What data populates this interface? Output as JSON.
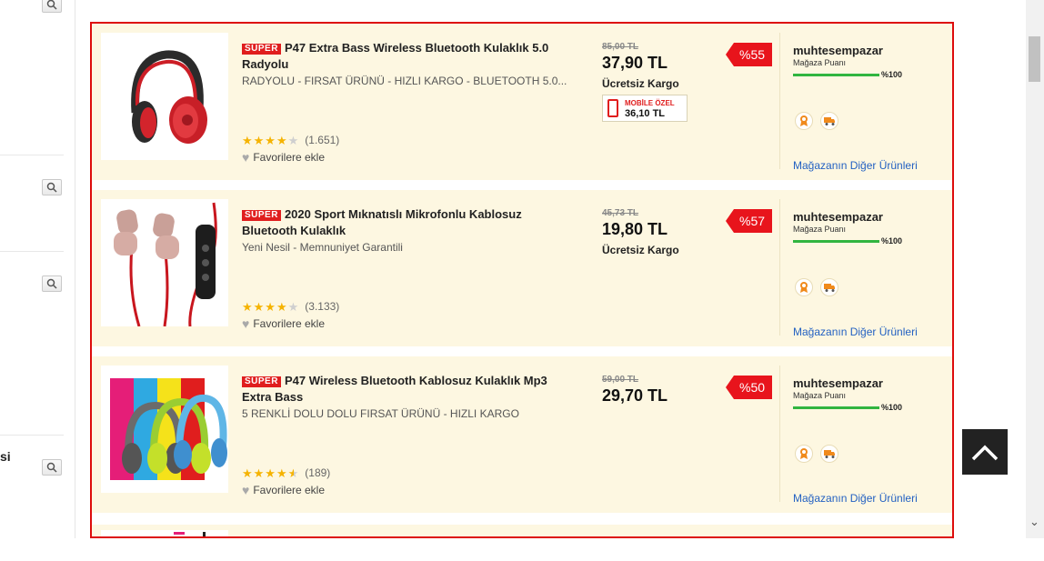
{
  "sidebar": {
    "partial_label": "si"
  },
  "products": [
    {
      "super_label": "SÜPER",
      "title": "P47 Extra Bass Wireless Bluetooth Kulaklık 5.0 Radyolu",
      "subtitle": "RADYOLU - FIRSAT ÜRÜNÜ - HIZLI KARGO - BLUETOOTH 5.0...",
      "rating_stars": 4,
      "review_count": "(1.651)",
      "favorite_label": "Favorilere ekle",
      "old_price": "85,00 TL",
      "price": "37,90 TL",
      "shipping": "Ücretsiz Kargo",
      "mobile_label": "MOBİLE ÖZEL",
      "mobile_price": "36,10 TL",
      "discount": "%55",
      "store_name": "muhtesempazar",
      "store_score_label": "Mağaza Puanı",
      "store_score": "%100",
      "store_link": "Mağazanın Diğer Ürünleri",
      "image_icon": "red-headphones"
    },
    {
      "super_label": "SÜPER",
      "title": "2020 Sport Mıknatıslı Mikrofonlu Kablosuz Bluetooth Kulaklık",
      "subtitle": "Yeni Nesil - Memnuniyet Garantili",
      "rating_stars": 4,
      "review_count": "(3.133)",
      "favorite_label": "Favorilere ekle",
      "old_price": "45,73 TL",
      "price": "19,80 TL",
      "shipping": "Ücretsiz Kargo",
      "discount": "%57",
      "store_name": "muhtesempazar",
      "store_score_label": "Mağaza Puanı",
      "store_score": "%100",
      "store_link": "Mağazanın Diğer Ürünleri",
      "image_icon": "sport-earphones"
    },
    {
      "super_label": "SÜPER",
      "title": "P47 Wireless Bluetooth Kablosuz Kulaklık Mp3 Extra Bass",
      "subtitle": "5 RENKLİ DOLU DOLU FIRSAT ÜRÜNÜ - HIZLI KARGO",
      "rating_stars": 4.5,
      "review_count": "(189)",
      "favorite_label": "Favorilere ekle",
      "old_price": "59,00 TL",
      "price": "29,70 TL",
      "discount": "%50",
      "store_name": "muhtesempazar",
      "store_score_label": "Mağaza Puanı",
      "store_score": "%100",
      "store_link": "Mağazanın Diğer Ürünleri",
      "image_icon": "colorful-headphones"
    }
  ],
  "colors": {
    "card_bg": "#fdf7e1",
    "list_border": "#dd0c0c",
    "discount": "#e8141c",
    "score_bar": "#31b540",
    "link": "#2361c2"
  }
}
